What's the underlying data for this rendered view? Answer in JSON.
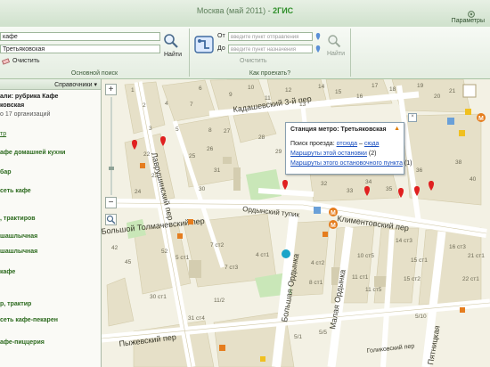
{
  "window": {
    "title": "Москва (май 2011)",
    "app_name": "2ГИС",
    "title_separator": " - ",
    "params_label": "Параметры"
  },
  "ribbon": {
    "main_search": {
      "field1_value": "кафе",
      "field2_value": "Третьяковская",
      "find_label": "Найти",
      "clear_label": "Очистить",
      "group_label": "Основной поиск"
    },
    "route_search": {
      "from_label": "От",
      "to_label": "До",
      "from_placeholder": "введите пункт отправления",
      "to_placeholder": "введите пункт назначения",
      "find_label": "Найти",
      "clear_label": "Очистить",
      "group_label": "Как проехать?"
    }
  },
  "sidebar": {
    "reference_label": "Справочники",
    "lines": [
      {
        "text": "али: рубрика Кафе",
        "style": "b"
      },
      {
        "text": "ковская",
        "style": "b"
      },
      {
        "text": "о 17 организаций",
        "style": "gr"
      },
      {
        "text": "тр",
        "style": "l"
      },
      {
        "text": "афе домашней кухни",
        "style": "lb"
      },
      {
        "text": "бар",
        "style": "lb"
      },
      {
        "text": "сеть кафе",
        "style": "lb"
      },
      {
        "text": ", трактиров",
        "style": "lb"
      },
      {
        "text": "шашлычная",
        "style": "lb"
      },
      {
        "text": "шашлычная",
        "style": "lb"
      },
      {
        "text": "кафе",
        "style": "lb"
      },
      {
        "text": "р, трактир",
        "style": "lb"
      },
      {
        "text": "сеть кафе-пекарен",
        "style": "lb"
      },
      {
        "text": "афе-пиццерия",
        "style": "lb"
      }
    ]
  },
  "map": {
    "streets": [
      "Кадашевский 3-й пер",
      "Ордынский тупик",
      "Климентовский пер",
      "Большой Толмачевский пер",
      "Пыжевский пер",
      "Большая Ордынка",
      "Малая Ордынка",
      "Голиковский пер",
      "Пятницкая",
      "Лаврушинский пер"
    ],
    "popup": {
      "title": "Станция метро: Третьяковская",
      "route_search_label": "Поиск проезда:",
      "from_here": "отсюда",
      "dash": " – ",
      "to_here": "сюда",
      "stop_routes": "Маршруты этой остановки",
      "stop_routes_count": "(2)",
      "point_routes": "Маршруты этого остановочного пункта",
      "point_routes_count": "(1)"
    },
    "house_numbers": [
      "1",
      "2",
      "3",
      "4",
      "5",
      "6",
      "7",
      "8",
      "9",
      "10",
      "11",
      "12",
      "13",
      "14",
      "15",
      "16",
      "17",
      "18",
      "19",
      "20",
      "21",
      "22",
      "23",
      "24",
      "25",
      "26",
      "27",
      "28",
      "29",
      "30",
      "31",
      "32",
      "33",
      "34",
      "35",
      "36",
      "38",
      "40",
      "42",
      "45",
      "52",
      "5 ст1",
      "7 ст2",
      "7 ст3",
      "4 ст1",
      "4 ст2",
      "8 ст1",
      "10 ст5",
      "11 ст1",
      "11 ст5",
      "14 ст3",
      "15 ст1",
      "15 ст2",
      "16 ст3",
      "21 ст1",
      "22 ст1",
      "30 ст1",
      "31 ст4",
      "11/2",
      "5/1",
      "5/5",
      "5/10"
    ]
  },
  "colors": {
    "title_green": "#2f8f2a",
    "map_background": "#f3f1e4",
    "block_color": "#e6e0c8",
    "park_color": "#c9e7b8",
    "road_color": "#ffffff",
    "pin_red": "#e02020",
    "metro_orange": "#e57d1e",
    "link_blue": "#1a4fc0"
  }
}
